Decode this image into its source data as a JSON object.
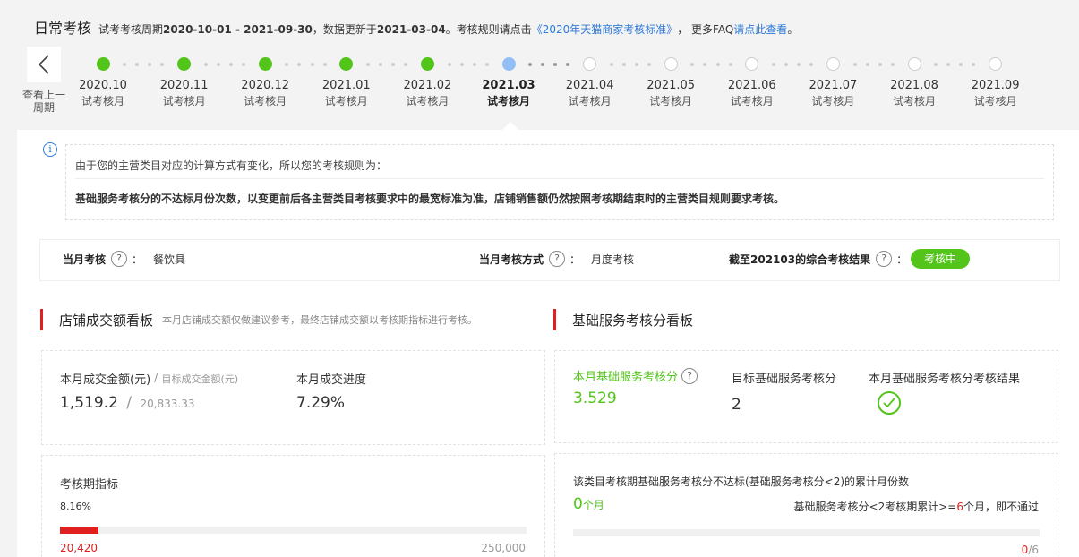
{
  "header": {
    "title": "日常考核",
    "period_prefix": "试考考核周期",
    "period_range": "2020-10-01 - 2021-09-30",
    "update_prefix": "，数据更新于",
    "update_date": "2021-03-04",
    "rules_prefix": "。考核规则请点击",
    "rules_link": "《2020年天猫商家考核标准》",
    "faq_prefix": "， 更多FAQ",
    "faq_link": "请点此查看",
    "faq_suffix": "。"
  },
  "nav": {
    "back_label": "查看上一周期"
  },
  "timeline": [
    {
      "date": "2020.10",
      "label": "试考核月",
      "status": "done"
    },
    {
      "date": "2020.11",
      "label": "试考核月",
      "status": "done"
    },
    {
      "date": "2020.12",
      "label": "试考核月",
      "status": "done"
    },
    {
      "date": "2021.01",
      "label": "试考核月",
      "status": "done"
    },
    {
      "date": "2021.02",
      "label": "试考核月",
      "status": "done"
    },
    {
      "date": "2021.03",
      "label": "试考核月",
      "status": "current"
    },
    {
      "date": "2021.04",
      "label": "试考核月",
      "status": "future"
    },
    {
      "date": "2021.05",
      "label": "试考核月",
      "status": "future"
    },
    {
      "date": "2021.06",
      "label": "试考核月",
      "status": "future"
    },
    {
      "date": "2021.07",
      "label": "试考核月",
      "status": "future"
    },
    {
      "date": "2021.08",
      "label": "试考核月",
      "status": "future"
    },
    {
      "date": "2021.09",
      "label": "试考核月",
      "status": "future"
    }
  ],
  "notice": {
    "line1": "由于您的主营类目对应的计算方式有变化，所以您的考核规则为：",
    "line2": "基础服务考核分的不达标月份次数，以变更前后各主营类目考核要求中的最宽标准为准，店铺销售额仍然按照考核期结束时的主营类目规则要求考核。"
  },
  "status_bar": {
    "month_label": "当月考核",
    "month_value": "餐饮具",
    "method_label": "当月考核方式",
    "method_value": "月度考核",
    "result_label": "截至202103的综合考核结果",
    "result_badge": "考核中",
    "colon": "："
  },
  "sales_board": {
    "title": "店铺成交额看板",
    "subtitle": "本月店铺成交额仅做建议参考，最终店铺成交额以考核期指标进行考核。",
    "amount_label": "本月成交金额(元)",
    "target_label": "目标成交金额(元)",
    "amount_value": "1,519.2",
    "target_value": "20,833.33",
    "progress_label": "本月成交进度",
    "progress_value": "7.29%",
    "period_label": "考核期指标",
    "period_percent": "8.16%",
    "period_current": "20,420",
    "period_total": "250,000",
    "period_fill": 0.0816
  },
  "service_board": {
    "title": "基础服务考核分看板",
    "score_label": "本月基础服务考核分",
    "score_value": "3.529",
    "target_label": "目标基础服务考核分",
    "target_value": "2",
    "result_label": "本月基础服务考核分考核结果",
    "fail_title": "该类目考核期基础服务考核分不达标(基础服务考核分<2)的累计月份数",
    "fail_count": "0",
    "fail_unit": "个月",
    "rule_prefix": "基础服务考核分<2考核期累计>=",
    "rule_count": "6",
    "rule_suffix": "个月，即不通过",
    "fail_current": "0",
    "fail_total": "/6",
    "fail_fill": 0
  },
  "colors": {
    "done": "#52c41a",
    "current": "#91bff5",
    "accent_red": "#e02020",
    "link_blue": "#2f7ad9"
  }
}
